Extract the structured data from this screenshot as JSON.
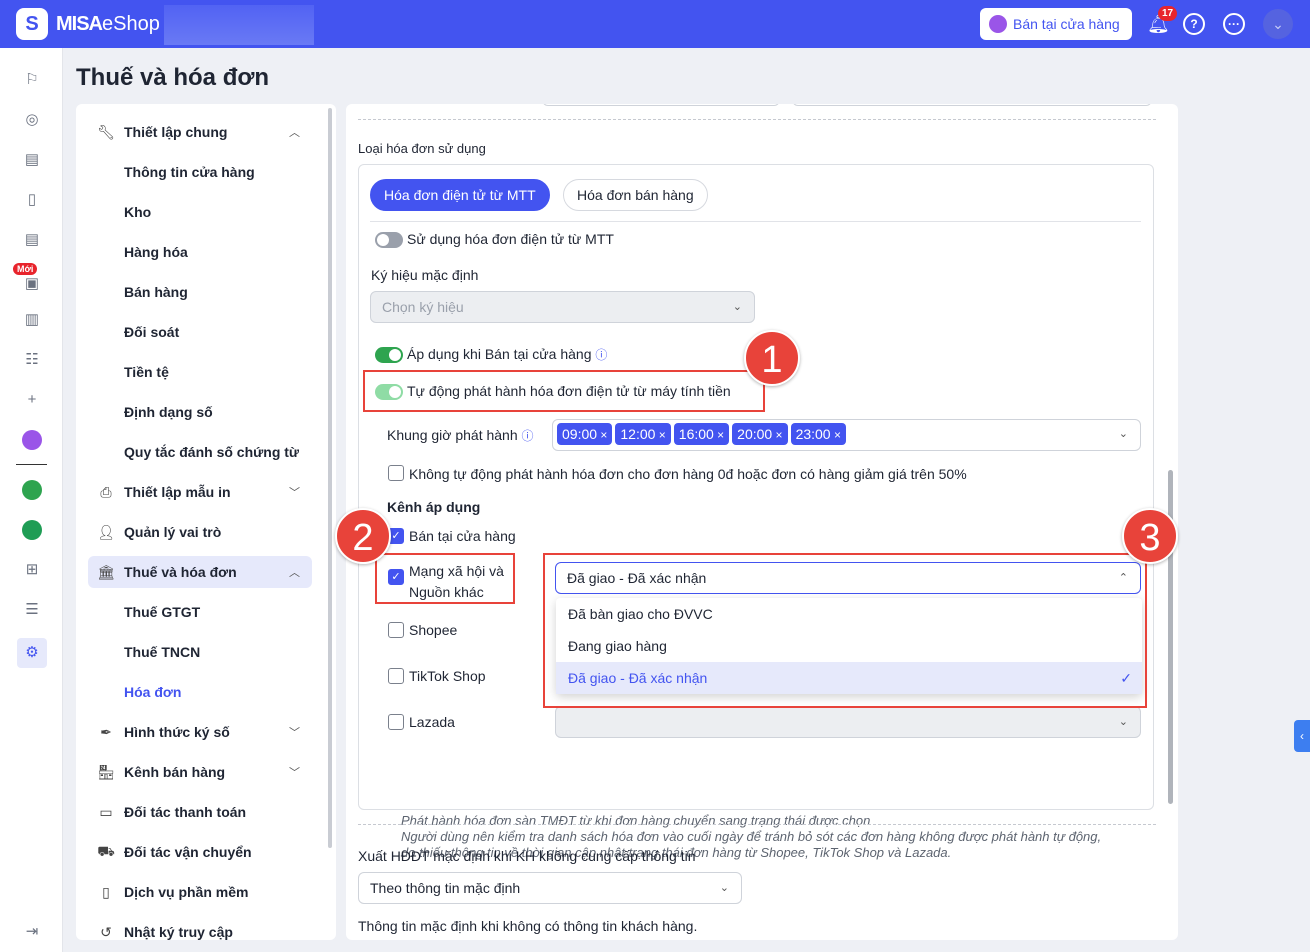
{
  "header": {
    "brand_bold": "MISA",
    "brand_light": "eShop",
    "store_button": "Bán tại cửa hàng",
    "notification_count": "17"
  },
  "rail": {
    "new_badge": "Mới"
  },
  "page_title": "Thuế và hóa đơn",
  "nav": [
    {
      "label": "Thiết lập chung",
      "icon": "wrench-icon",
      "chev": "up"
    },
    {
      "label": "Thông tin cửa hàng",
      "sub": true
    },
    {
      "label": "Kho",
      "sub": true
    },
    {
      "label": "Hàng hóa",
      "sub": true
    },
    {
      "label": "Bán hàng",
      "sub": true
    },
    {
      "label": "Đối soát",
      "sub": true
    },
    {
      "label": "Tiền tệ",
      "sub": true
    },
    {
      "label": "Định dạng số",
      "sub": true
    },
    {
      "label": "Quy tắc đánh số chứng từ",
      "sub": true
    },
    {
      "label": "Thiết lập mẫu in",
      "icon": "printer-icon",
      "chev": "down"
    },
    {
      "label": "Quản lý vai trò",
      "icon": "user-role-icon"
    },
    {
      "label": "Thuế và hóa đơn",
      "icon": "bank-icon",
      "chev": "up",
      "active": true
    },
    {
      "label": "Thuế GTGT",
      "sub": true
    },
    {
      "label": "Thuế TNCN",
      "sub": true
    },
    {
      "label": "Hóa đơn",
      "sub": true,
      "current": true
    },
    {
      "label": "Hình thức ký số",
      "icon": "feather-icon",
      "chev": "down"
    },
    {
      "label": "Kênh bán hàng",
      "icon": "store-icon",
      "chev": "down"
    },
    {
      "label": "Đối tác thanh toán",
      "icon": "card-icon"
    },
    {
      "label": "Đối tác vận chuyển",
      "icon": "truck-icon"
    },
    {
      "label": "Dịch vụ phần mềm",
      "icon": "document-icon"
    },
    {
      "label": "Nhật ký truy cập",
      "icon": "history-icon"
    }
  ],
  "invoice": {
    "section_label": "Loại hóa đơn sử dụng",
    "tabs": [
      "Hóa đơn điện tử từ MTT",
      "Hóa đơn bán hàng"
    ],
    "use_toggle": "Sử dụng hóa đơn điện tử từ MTT",
    "symbol_label": "Ký hiệu mặc định",
    "symbol_placeholder": "Chọn ký hiệu",
    "apply_store": "Áp dụng khi Bán tại cửa hàng",
    "auto_issue": "Tự động phát hành hóa đơn điện tử từ máy tính tiền",
    "time_label": "Khung giờ phát hành",
    "times": [
      "09:00",
      "12:00",
      "16:00",
      "20:00",
      "23:00"
    ],
    "skip_zero": "Không tự động phát hành hóa đơn cho đơn hàng 0đ hoặc đơn có hàng giảm giá trên 50%",
    "channel_label": "Kênh áp dụng",
    "channels": [
      {
        "label": "Bán tại cửa hàng",
        "checked": true
      },
      {
        "label1": "Mạng xã hội và",
        "label2": "Nguồn khác",
        "checked": true
      },
      {
        "label": "Shopee",
        "checked": false
      },
      {
        "label": "TikTok Shop",
        "checked": false
      },
      {
        "label": "Lazada",
        "checked": false
      }
    ],
    "status_selected": "Đã giao - Đã xác nhận",
    "status_options": [
      "Đã bàn giao cho ĐVVC",
      "Đang giao hàng",
      "Đã giao - Đã xác nhận"
    ],
    "notes": [
      "Phát hành hóa đơn sàn TMĐT từ khi đơn hàng chuyển sang trạng thái được chọn",
      "Người dùng nên kiểm tra danh sách hóa đơn vào cuối ngày để tránh bỏ sót các đơn hàng không được phát hành tự động,",
      "do thiếu thông tin về thời gian cập nhật trạng thái đơn hàng từ Shopee, TikTok Shop và Lazada."
    ],
    "default_export_label": "Xuất HĐĐT mặc định khi KH không cung cấp thông tin",
    "default_export_value": "Theo thông tin mặc định",
    "default_info_label": "Thông tin mặc định khi không có thông tin khách hàng."
  },
  "annotations": [
    "1",
    "2",
    "3"
  ],
  "colors": {
    "primary": "#4354f0",
    "annotation": "#e8433a",
    "toggle_on": "#2ea44f"
  }
}
